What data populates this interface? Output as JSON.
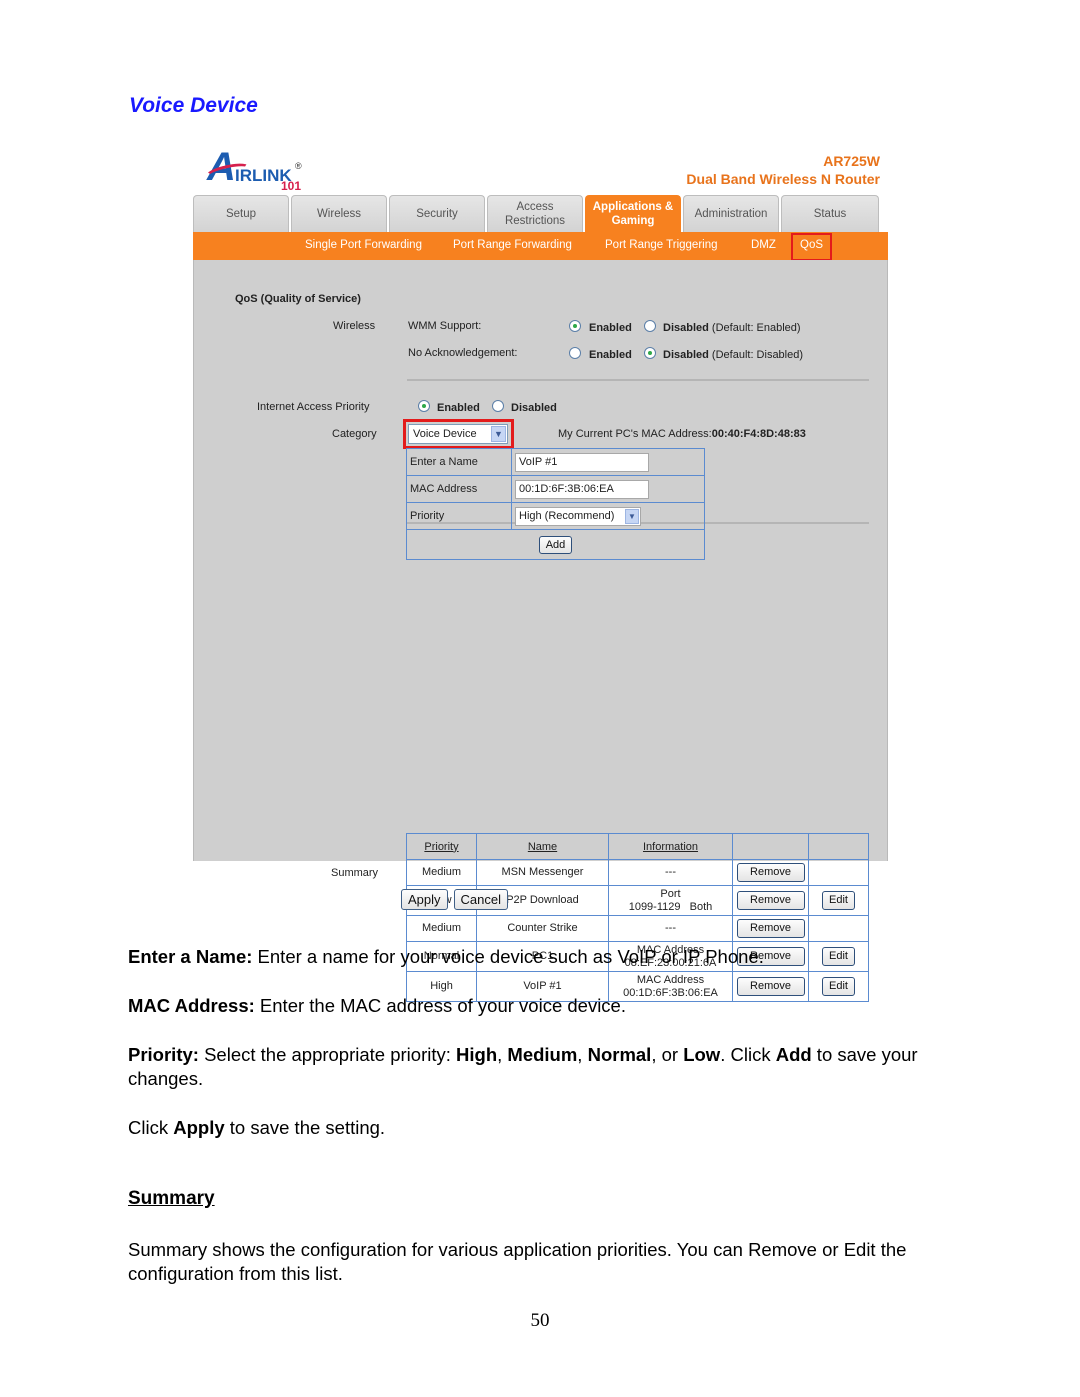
{
  "section_title": "Voice Device",
  "router_ui": {
    "logo": {
      "a": "A",
      "name": "IRLINK",
      "registered": "®",
      "number": "101"
    },
    "model": "AR725W",
    "product": "Dual Band Wireless N Router",
    "tabs": [
      {
        "label": "Setup",
        "active": false
      },
      {
        "label": "Wireless",
        "active": false
      },
      {
        "label": "Security",
        "active": false
      },
      {
        "label": "Access Restrictions",
        "active": false
      },
      {
        "label": "Applications & Gaming",
        "active": true
      },
      {
        "label": "Administration",
        "active": false
      },
      {
        "label": "Status",
        "active": false
      }
    ],
    "subnav": [
      "Single Port Forwarding",
      "Port Range Forwarding",
      "Port Range Triggering",
      "DMZ",
      "QoS"
    ],
    "subnav_active": "QoS",
    "qos_heading": "QoS (Quality of Service)",
    "wireless_label": "Wireless",
    "wmm": {
      "label": "WMM Support:",
      "enabled": "Enabled",
      "disabled": "Disabled",
      "default": "(Default: Enabled)",
      "selected": "Enabled"
    },
    "noack": {
      "label": "No Acknowledgement:",
      "enabled": "Enabled",
      "disabled": "Disabled",
      "default": "(Default: Disabled)",
      "selected": "Disabled"
    },
    "iap": {
      "label": "Internet Access Priority",
      "enabled": "Enabled",
      "disabled": "Disabled",
      "selected": "Enabled"
    },
    "category": {
      "label": "Category",
      "value": "Voice Device"
    },
    "my_mac_label": "My Current PC's MAC Address:",
    "my_mac_value": "00:40:F4:8D:48:83",
    "form": {
      "name_label": "Enter a Name",
      "name_value": "VoIP #1",
      "mac_label": "MAC Address",
      "mac_value": "00:1D:6F:3B:06:EA",
      "priority_label": "Priority",
      "priority_value": "High (Recommend)",
      "add_label": "Add"
    },
    "summary": {
      "label": "Summary",
      "headers": [
        "Priority",
        "Name",
        "Information"
      ],
      "remove_label": "Remove",
      "edit_label": "Edit",
      "rows": [
        {
          "priority": "Medium",
          "name": "MSN Messenger",
          "info1": "---",
          "info2": "",
          "edit": false
        },
        {
          "priority": "Low",
          "name": "P2P Download",
          "info1": "Port",
          "info2": "1099-1129   Both",
          "edit": true
        },
        {
          "priority": "Medium",
          "name": "Counter Strike",
          "info1": "---",
          "info2": "",
          "edit": false
        },
        {
          "priority": "Normal",
          "name": "PC1",
          "info1": "MAC Address",
          "info2": "08:EF:23:00:21:6A",
          "edit": true
        },
        {
          "priority": "High",
          "name": "VoIP #1",
          "info1": "MAC Address",
          "info2": "00:1D:6F:3B:06:EA",
          "edit": true
        }
      ]
    },
    "apply_label": "Apply",
    "cancel_label": "Cancel"
  },
  "doc": {
    "p1_bold": "Enter a Name:",
    "p1_text": " Enter a name for your voice device such as VoIP or IP Phone.",
    "p2_bold": "MAC Address:",
    "p2_text": " Enter the MAC address of your voice device.",
    "p3_bold": "Priority:",
    "p3_a": " Select the appropriate priority: ",
    "p3_high": "High",
    "p3_sep1": ", ",
    "p3_medium": "Medium",
    "p3_sep2": ", ",
    "p3_normal": "Normal",
    "p3_or": ", or ",
    "p3_low": "Low",
    "p3_click": ". Click ",
    "p3_add": "Add",
    "p3_end": " to save your changes.",
    "p4_a": "Click ",
    "p4_apply": "Apply",
    "p4_end": " to save the setting.",
    "summary_title": "Summary",
    "p5": "Summary shows the configuration for various application priorities. You can Remove or Edit the configuration from this list.",
    "page_number": "50"
  }
}
